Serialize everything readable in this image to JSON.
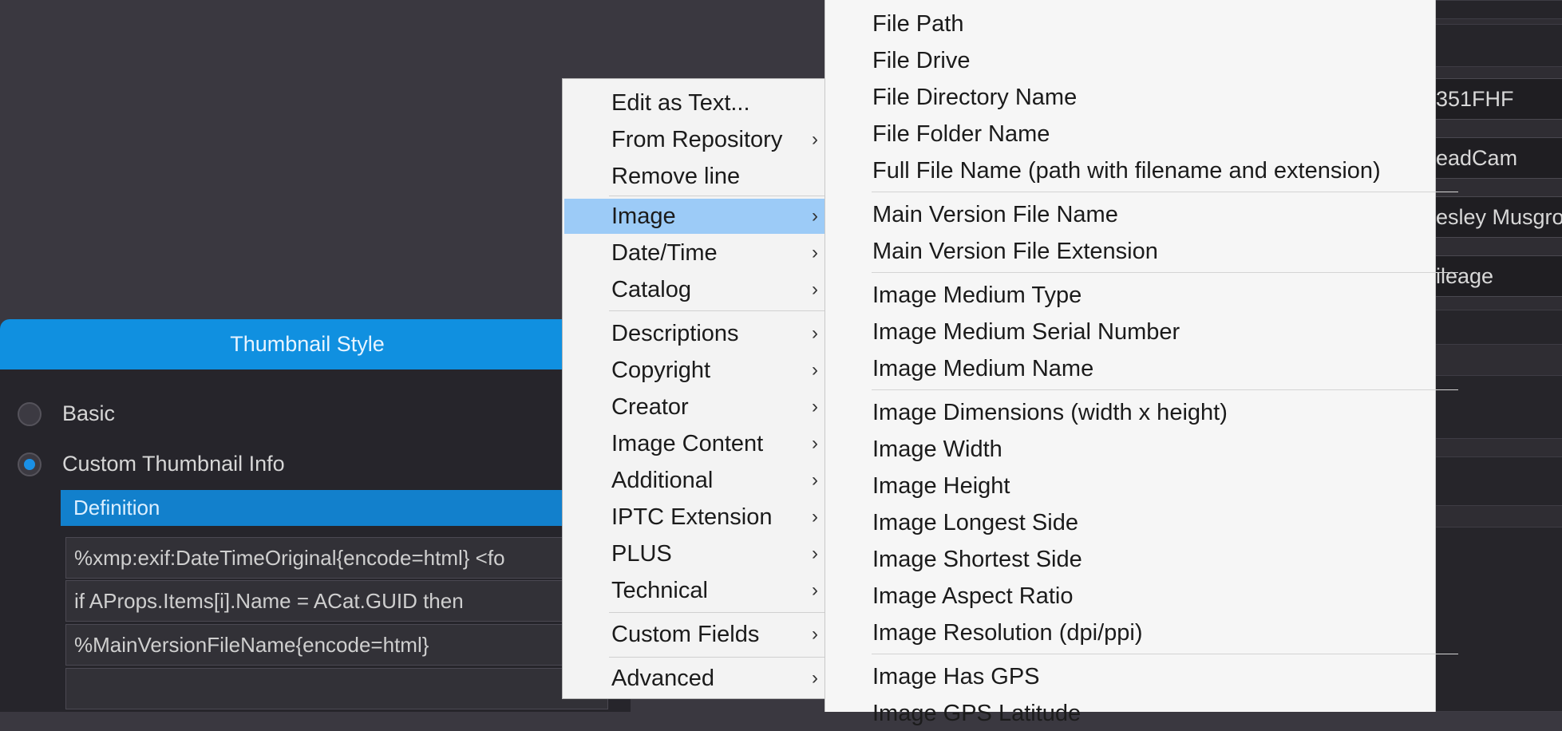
{
  "right_fields": [
    "351FHF",
    "eadCam",
    "esley Musgro",
    "ileage"
  ],
  "dialog": {
    "title": "Thumbnail Style",
    "radio_basic": "Basic",
    "radio_custom": "Custom Thumbnail Info",
    "definition_header": "Definition",
    "lines": [
      "%xmp:exif:DateTimeOriginal{encode=html}  <fo",
      "      if AProps.Items[i].Name = ACat.GUID then",
      "%MainVersionFileName{encode=html}",
      ""
    ]
  },
  "menu": {
    "edit_as_text": "Edit as Text...",
    "from_repository": "From Repository",
    "remove_line": "Remove line",
    "image": "Image",
    "date_time": "Date/Time",
    "catalog": "Catalog",
    "descriptions": "Descriptions",
    "copyright": "Copyright",
    "creator": "Creator",
    "image_content": "Image Content",
    "additional": "Additional",
    "iptc_extension": "IPTC Extension",
    "plus": "PLUS",
    "technical": "Technical",
    "custom_fields": "Custom Fields",
    "advanced": "Advanced",
    "chevron": "›"
  },
  "submenu": {
    "file_path": "File Path",
    "file_drive": "File Drive",
    "file_directory_name": "File Directory Name",
    "file_folder_name": "File Folder Name",
    "full_file_name": "Full File Name (path with filename and extension)",
    "main_version_file_name": "Main Version File Name",
    "main_version_file_extension": "Main Version File Extension",
    "image_medium_type": "Image Medium Type",
    "image_medium_serial_number": "Image Medium Serial Number",
    "image_medium_name": "Image Medium Name",
    "image_dimensions": "Image Dimensions (width x height)",
    "image_width": "Image Width",
    "image_height": "Image Height",
    "image_longest_side": "Image Longest Side",
    "image_shortest_side": "Image Shortest Side",
    "image_aspect_ratio": "Image Aspect Ratio",
    "image_resolution": "Image Resolution (dpi/ppi)",
    "image_has_gps": "Image Has GPS",
    "image_gps_latitude": "Image GPS Latitude"
  }
}
